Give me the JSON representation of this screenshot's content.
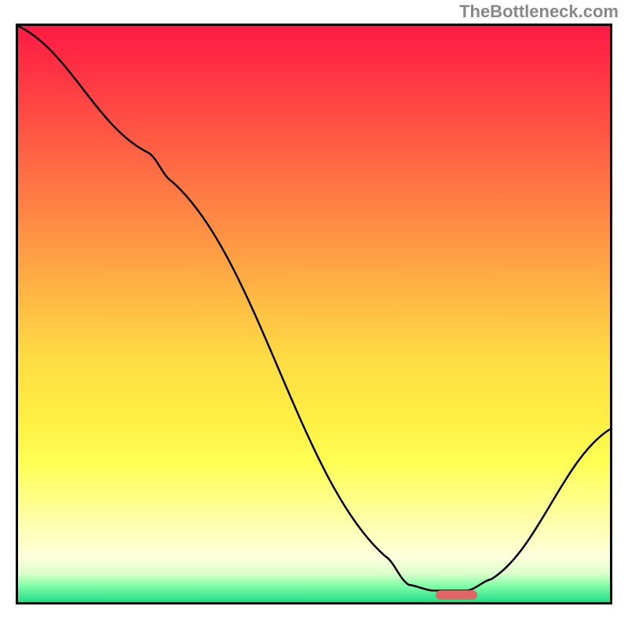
{
  "watermark": "TheBottleneck.com",
  "chart_data": {
    "type": "line",
    "title": "",
    "xlabel": "",
    "ylabel": "",
    "x_range": [
      0,
      100
    ],
    "y_range": [
      0,
      100
    ],
    "series": [
      {
        "name": "curve",
        "points": [
          {
            "x": 0,
            "y": 100
          },
          {
            "x": 22,
            "y": 78
          },
          {
            "x": 26,
            "y": 73
          },
          {
            "x": 62,
            "y": 8
          },
          {
            "x": 66,
            "y": 3
          },
          {
            "x": 70,
            "y": 2
          },
          {
            "x": 76,
            "y": 2
          },
          {
            "x": 80,
            "y": 4
          },
          {
            "x": 100,
            "y": 30
          }
        ]
      }
    ],
    "marker": {
      "x_start": 70,
      "x_end": 77,
      "y": 2,
      "color": "#e06666"
    },
    "gradient": {
      "top": "#ff1a44",
      "mid": "#ffee44",
      "bottom": "#22dd88"
    }
  }
}
